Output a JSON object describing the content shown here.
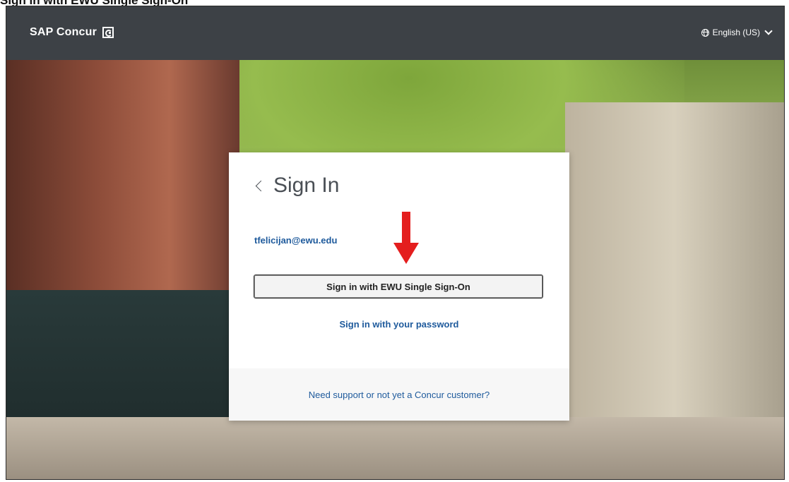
{
  "header": {
    "brand_name": "SAP Concur",
    "brand_logo_icon": "concur-logo-icon",
    "language_label": "English (US)",
    "language_icon": "globe-icon",
    "language_dropdown_icon": "chevron-down-icon",
    "bar_color": "#3d4146"
  },
  "signin": {
    "back_icon": "chevron-left-icon",
    "title": "Sign In",
    "email": "tfelicijan@ewu.edu",
    "sso_button_label": "Sign in with EWU Single Sign-On",
    "password_link": "Sign in with your password",
    "support_link": "Need support or not yet a Concur customer?",
    "link_color": "#1e5a9c"
  },
  "annotation": {
    "arrow_icon": "red-down-arrow-icon",
    "arrow_color": "#e41e1e"
  }
}
